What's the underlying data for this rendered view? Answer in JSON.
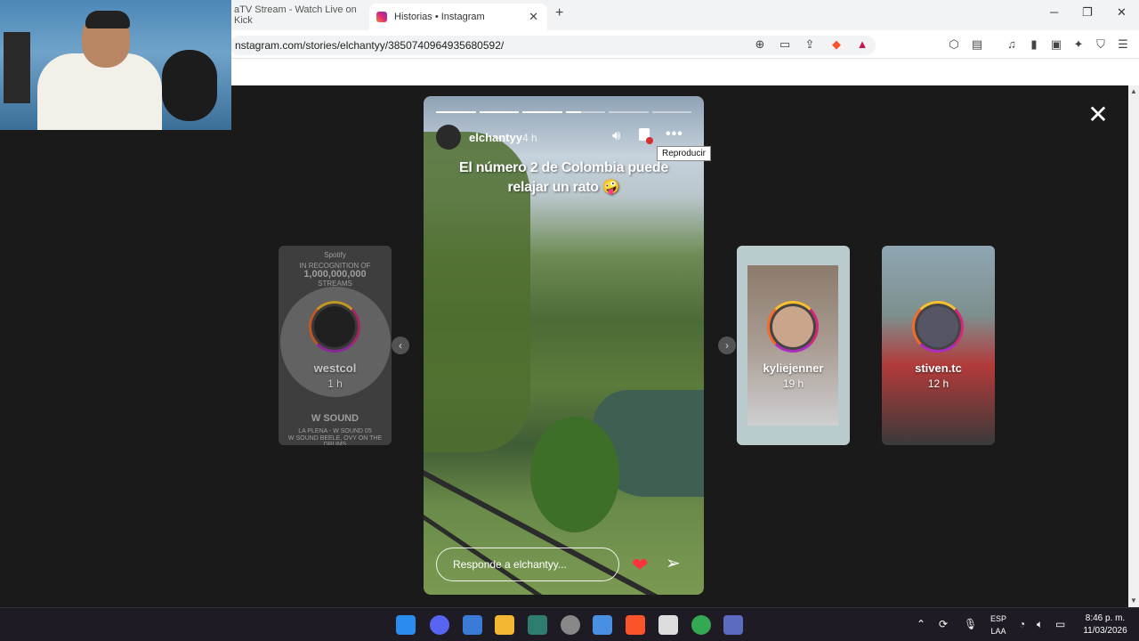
{
  "browser": {
    "tabs": [
      {
        "title": "aTV Stream - Watch Live on Kick",
        "active": false
      },
      {
        "title": "Historias • Instagram",
        "active": true
      }
    ],
    "url": "nstagram.com/stories/elchantyy/3850740964935680592/",
    "new_tab_symbol": "+"
  },
  "story": {
    "username": "elchantyy",
    "time": "4 h",
    "caption_line1": "El número 2 de Colombia puede",
    "caption_line2": "relajar un rato 🤪",
    "tooltip": "Reproducir",
    "reply_placeholder": "Responde a elchantyy...",
    "progress": [
      1.0,
      1.0,
      1.0,
      0.4,
      0.0,
      0.0
    ]
  },
  "previews": {
    "prev": {
      "username": "westcol",
      "time": "1 h",
      "top_text_1": "Spotify",
      "top_text_2": "IN RECOGNITION OF",
      "top_text_3": "1,000,000,000",
      "top_text_4": "STREAMS",
      "bottom_title": "W SOUND",
      "bottom_sub_1": "LA PLENA - W SOUND 05",
      "bottom_sub_2": "W SOUND  BEELE, OVY ON THE DRUMS"
    },
    "next1": {
      "username": "kyliejenner",
      "time": "19 h"
    },
    "next2": {
      "username": "stiven.tc",
      "time": "12 h"
    }
  },
  "taskbar": {
    "language_1": "ESP",
    "language_2": "LAA",
    "time": "8:46 p. m.",
    "date": "11/03/2026"
  },
  "colors": {
    "accent_heart": "#ff3040",
    "page_bg": "#1a1a1a"
  }
}
